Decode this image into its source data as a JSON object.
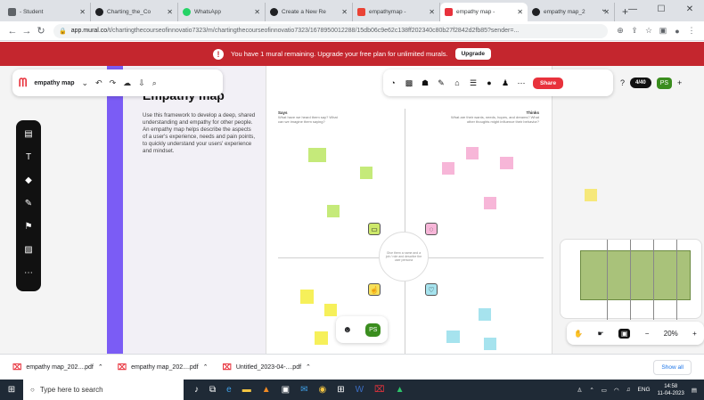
{
  "browser": {
    "tabs": [
      {
        "label": "- Student",
        "icon_color": "#5f6368"
      },
      {
        "label": "Charting_the_Co",
        "icon_color": "#202124"
      },
      {
        "label": "WhatsApp",
        "icon_color": "#25d366"
      },
      {
        "label": "Create a New Re",
        "icon_color": "#202124"
      },
      {
        "label": "empathymap - ",
        "icon_color": "#ea4335"
      },
      {
        "label": "empathy map - ",
        "icon_color": "#e8323c"
      },
      {
        "label": "empathy map_2",
        "icon_color": "#202124"
      }
    ],
    "active_tab": 5,
    "new_tab": "+",
    "url_domain": "app.mural.co",
    "url_path": "/t/chartingthecourseofinnovatio7323/m/chartingthecourseofinnovatio7323/1678950012288/15db06c9e62c138ff202340c80b27f2842d2fb85?sender=..."
  },
  "banner": {
    "message": "You have 1 mural remaining. Upgrade your free plan for unlimited murals.",
    "button": "Upgrade",
    "color": "#c4262e"
  },
  "mural": {
    "board_name": "empathy map",
    "intro_title": "Empathy map",
    "intro_text": "Use this framework to develop a deep, shared understanding and empathy for other people. An empathy map helps describe the aspects of a user's experience, needs and pain points, to quickly understand your users' experience and mindset.",
    "share_label": "Share",
    "participants": "4/40",
    "avatar_initials": "PS",
    "zoom": "20%",
    "quadrants": {
      "says": {
        "title": "Says",
        "desc": "What have we heard them say? What can we imagine them saying?"
      },
      "thinks": {
        "title": "Thinks",
        "desc": "What are their wants, needs, hopes, and dreams? What other thoughts might influence their behavior?"
      },
      "center": "Give them a name and a job / role and describe the user persona"
    },
    "accent": "#7b5cf5"
  },
  "downloads": {
    "items": [
      "empathy map_202....pdf",
      "empathy map_202....pdf",
      "Untitled_2023-04-....pdf"
    ],
    "show_all": "Show all"
  },
  "taskbar": {
    "search_placeholder": "Type here to search",
    "language": "ENG",
    "time": "14:58",
    "date": "11-04-2023"
  }
}
